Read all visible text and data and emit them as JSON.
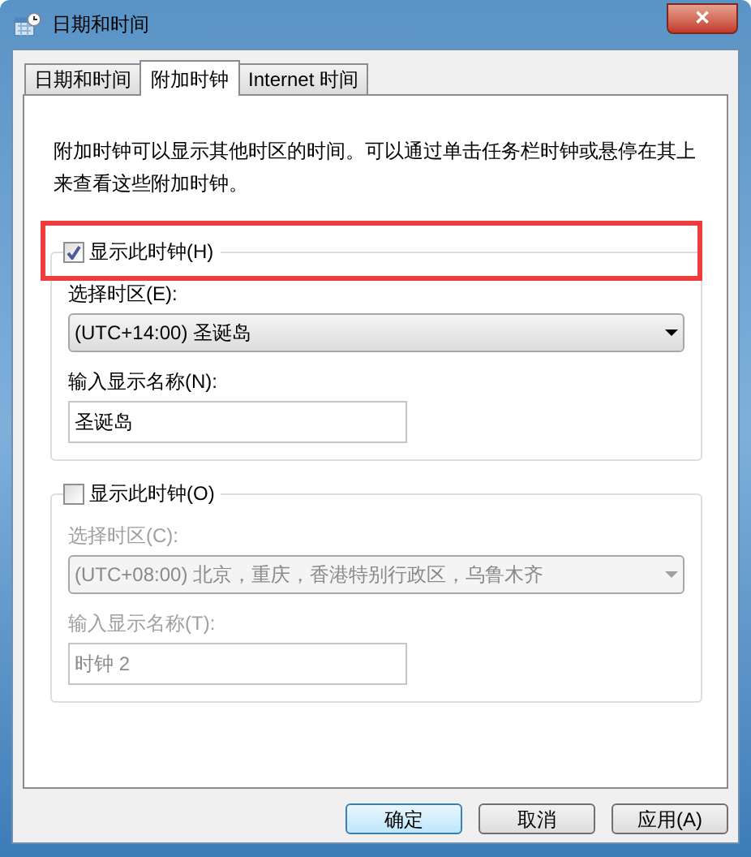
{
  "window": {
    "title": "日期和时间",
    "close_glyph": "✕"
  },
  "tabs": [
    {
      "label": "日期和时间",
      "selected": false
    },
    {
      "label": "附加时钟",
      "selected": true
    },
    {
      "label": "Internet 时间",
      "selected": false
    }
  ],
  "description": "附加时钟可以显示其他时区的时间。可以通过单击任务栏时钟或悬停在其上来查看这些附加时钟。",
  "clocks": [
    {
      "show_label": "显示此时钟(H)",
      "checked": true,
      "disabled": false,
      "timezone_label": "选择时区(E):",
      "timezone": "(UTC+14:00) 圣诞岛",
      "name_label": "输入显示名称(N):",
      "name": "圣诞岛"
    },
    {
      "show_label": "显示此时钟(O)",
      "checked": false,
      "disabled": true,
      "timezone_label": "选择时区(C):",
      "timezone": "(UTC+08:00) 北京，重庆，香港特别行政区，乌鲁木齐",
      "name_label": "输入显示名称(T):",
      "name": "时钟 2"
    }
  ],
  "buttons": [
    {
      "label": "确定",
      "default": true
    },
    {
      "label": "取消",
      "default": false
    },
    {
      "label": "应用(A)",
      "default": false
    }
  ]
}
